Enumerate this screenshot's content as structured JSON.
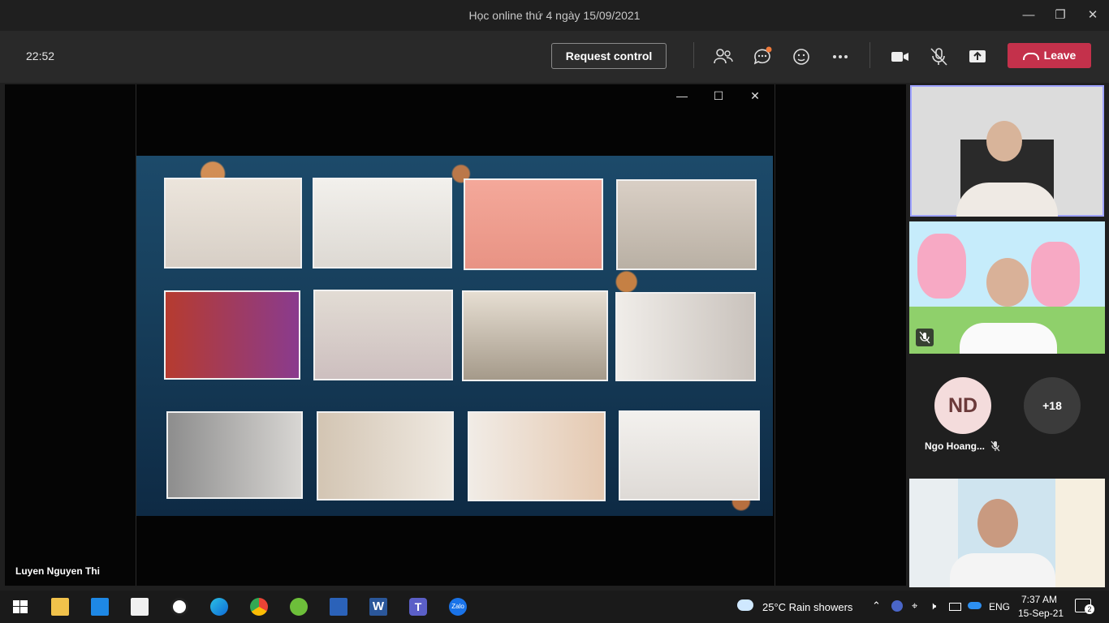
{
  "window": {
    "title": "Học online thứ 4 ngày 15/09/2021"
  },
  "toolbar": {
    "timer": "22:52",
    "request_control": "Request control",
    "leave": "Leave"
  },
  "stage": {
    "speaker_name": "Luyen Nguyen Thi"
  },
  "participants": {
    "avatar_initials": "ND",
    "avatar_name": "Ngo Hoang...",
    "overflow": "+18"
  },
  "colors": {
    "leave": "#c4314b",
    "active_border": "#9ea2ff",
    "background": "#1f1f1f"
  },
  "taskbar": {
    "weather": "25°C  Rain showers",
    "lang": "ENG",
    "time": "7:37 AM",
    "date": "15-Sep-21",
    "notifications": "2",
    "apps": [
      "windows-start",
      "file-explorer",
      "mail",
      "store",
      "app-red",
      "edge",
      "chrome",
      "coc-coc",
      "word-like",
      "word",
      "teams",
      "zalo"
    ]
  }
}
